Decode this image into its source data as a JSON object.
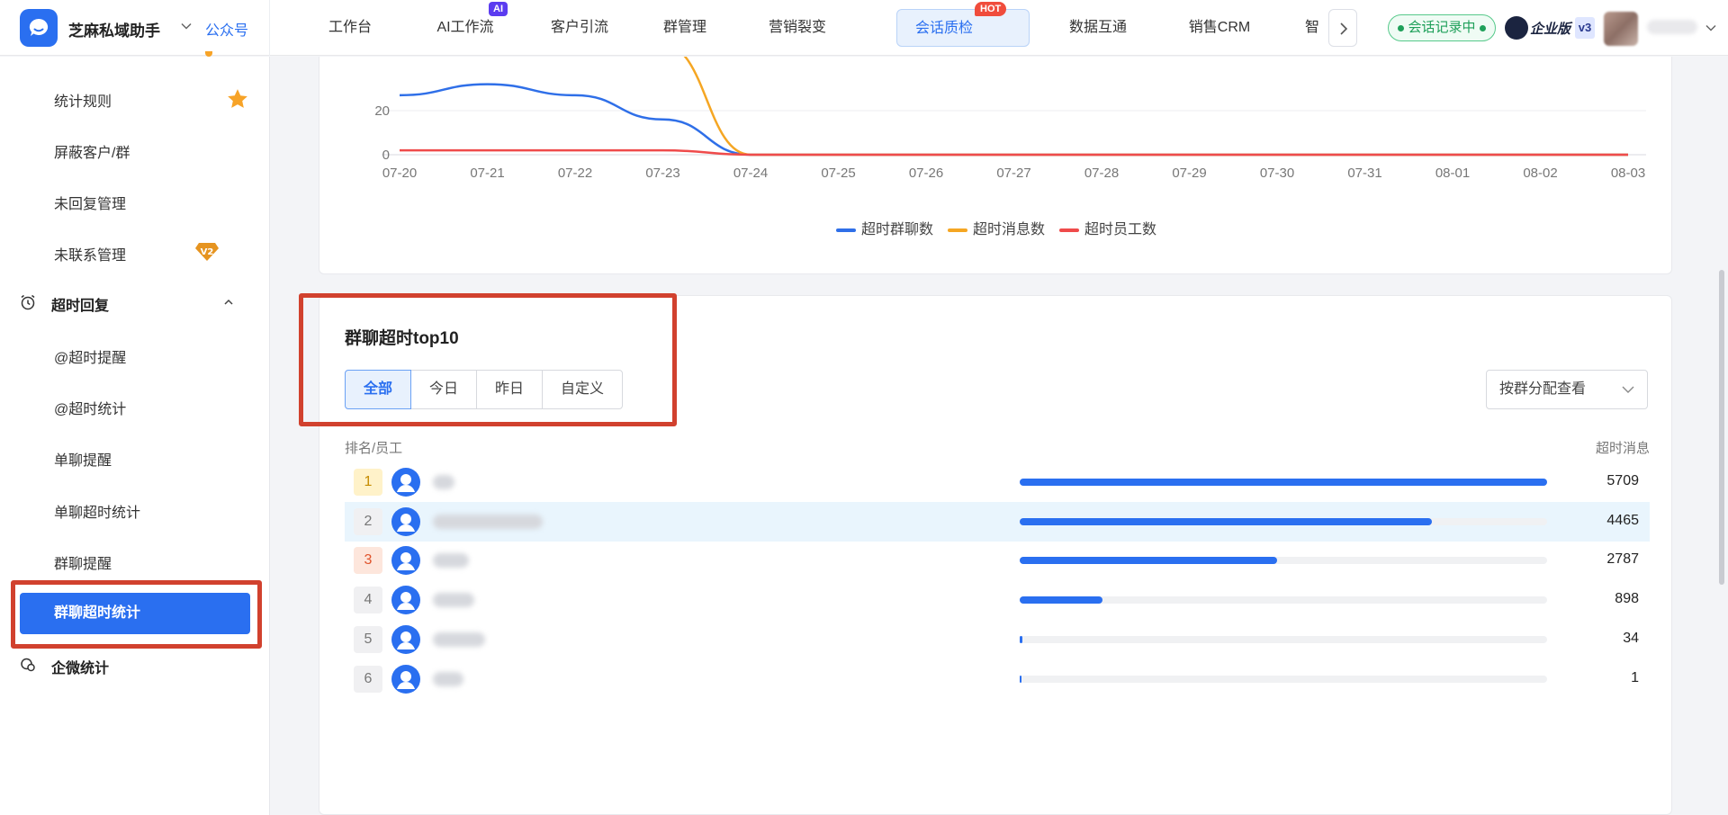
{
  "header": {
    "brand_name": "芝麻私域助手",
    "account_type": "公众号",
    "nav": [
      {
        "label": "工作台",
        "badge": ""
      },
      {
        "label": "AI工作流",
        "badge": "AI"
      },
      {
        "label": "客户引流",
        "badge": ""
      },
      {
        "label": "群管理",
        "badge": ""
      },
      {
        "label": "营销裂变",
        "badge": ""
      },
      {
        "label": "会话质检",
        "badge": "HOT",
        "active": true
      },
      {
        "label": "数据互通",
        "badge": ""
      },
      {
        "label": "销售CRM",
        "badge": ""
      },
      {
        "label": "智",
        "badge": ""
      }
    ],
    "recording_status": "会话记录中",
    "edition": "企业版",
    "version": "v3"
  },
  "sidebar": {
    "items": [
      {
        "label": "统计规则",
        "badge_icon": "star-icon"
      },
      {
        "label": "屏蔽客户/群"
      },
      {
        "label": "未回复管理"
      },
      {
        "label": "未联系管理",
        "badge_icon": "v2-badge-icon"
      }
    ],
    "group_timeout": {
      "label": "超时回复",
      "items": [
        "@超时提醒",
        "@超时统计",
        "单聊提醒",
        "单聊超时统计",
        "群聊提醒",
        "群聊超时统计"
      ],
      "active": "群聊超时统计"
    },
    "group_wecom": {
      "label": "企微统计"
    }
  },
  "chart_data": {
    "type": "line",
    "x": [
      "07-20",
      "07-21",
      "07-22",
      "07-23",
      "07-24",
      "07-25",
      "07-26",
      "07-27",
      "07-28",
      "07-29",
      "07-30",
      "07-31",
      "08-01",
      "08-02",
      "08-03"
    ],
    "y_ticks_visible": [
      "20",
      "0"
    ],
    "series": [
      {
        "name": "超时群聊数",
        "color": "#2f6fe8",
        "values": [
          27,
          32,
          27,
          16,
          0,
          0,
          0,
          0,
          0,
          0,
          0,
          0,
          0,
          0,
          0
        ]
      },
      {
        "name": "超时消息数",
        "color": "#f5a623",
        "values": [
          null,
          null,
          null,
          50,
          0,
          0,
          0,
          0,
          0,
          0,
          0,
          0,
          0,
          0,
          0
        ]
      },
      {
        "name": "超时员工数",
        "color": "#ef4b4b",
        "values": [
          2,
          2,
          2,
          2,
          0,
          0,
          0,
          0,
          0,
          0,
          0,
          0,
          0,
          0,
          0
        ]
      }
    ]
  },
  "top10": {
    "title": "群聊超时top10",
    "filters": [
      "全部",
      "今日",
      "昨日",
      "自定义"
    ],
    "active_filter": "全部",
    "select_value": "按群分配查看",
    "col_left": "排名/员工",
    "col_right": "超时消息",
    "rows": [
      {
        "rank": "1",
        "value": 5709,
        "value_text": "5709"
      },
      {
        "rank": "2",
        "value": 4465,
        "value_text": "4465"
      },
      {
        "rank": "3",
        "value": 2787,
        "value_text": "2787"
      },
      {
        "rank": "4",
        "value": 898,
        "value_text": "898"
      },
      {
        "rank": "5",
        "value": 34,
        "value_text": "34"
      },
      {
        "rank": "6",
        "value": 1,
        "value_text": "1"
      }
    ]
  }
}
